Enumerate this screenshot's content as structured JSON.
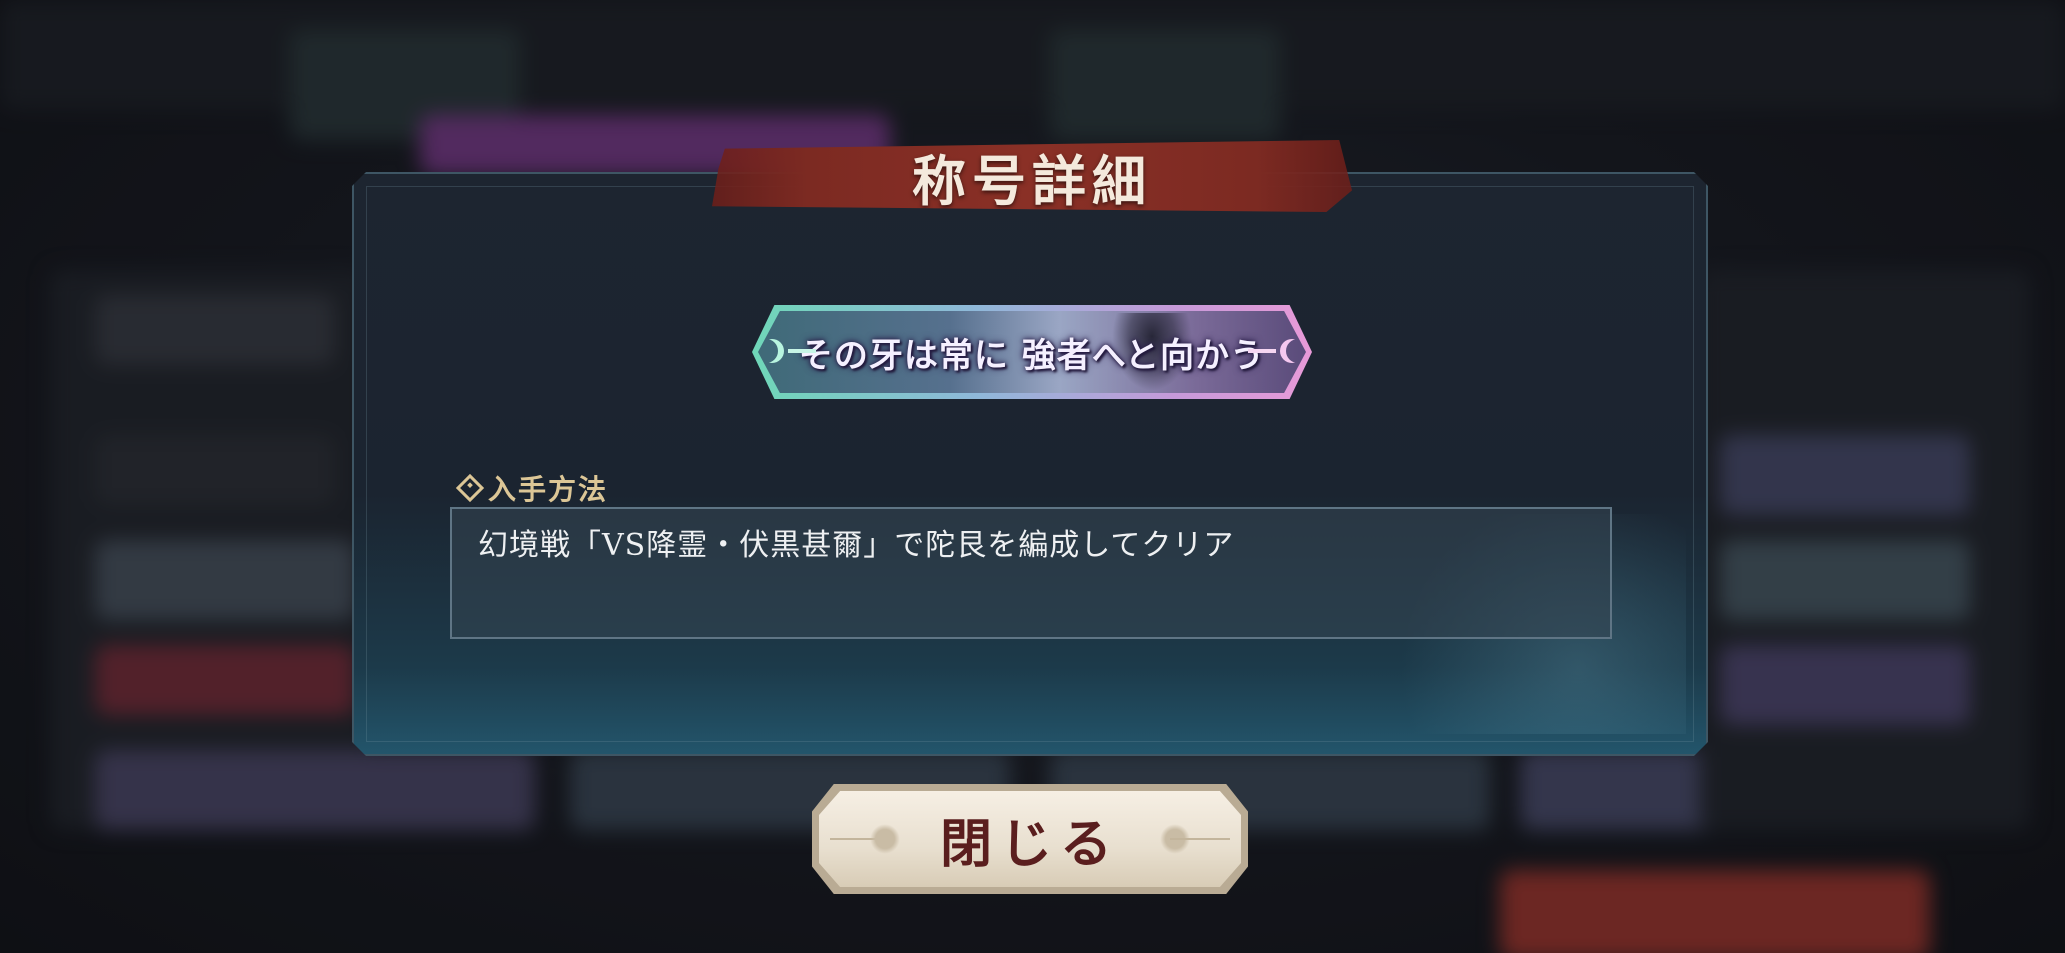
{
  "dialog": {
    "title": "称号詳細",
    "badge_text": "その牙は常に 強者へと向かう",
    "section_label": "入手方法",
    "description": "幻境戦「VS降霊・伏黒甚爾」で陀艮を編成してクリア",
    "close_label": "閉じる"
  },
  "icons": {
    "section_marker": "diamond-icon"
  },
  "colors": {
    "title_banner": "#8a3026",
    "title_text": "#f4e9dc",
    "section_label": "#dcc696",
    "close_label": "#5a1e1e"
  }
}
